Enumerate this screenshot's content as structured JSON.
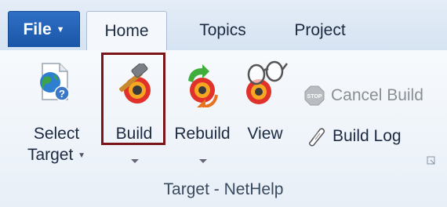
{
  "tabs": {
    "file": "File",
    "home": "Home",
    "topics": "Topics",
    "project": "Project"
  },
  "commands": {
    "select_target_line1": "Select",
    "select_target_line2": "Target",
    "build": "Build",
    "rebuild": "Rebuild",
    "view": "View",
    "cancel_build": "Cancel Build",
    "build_log": "Build Log"
  },
  "group": {
    "label": "Target - NetHelp"
  },
  "colors": {
    "file_tab": "#1a56a8",
    "highlight_border": "#7a1518",
    "disabled_text": "#8a8f96"
  },
  "icons": {
    "select_target": "globe-page-help-icon",
    "build": "hammer-disc-icon",
    "rebuild": "rebuild-arrows-disc-icon",
    "view": "glasses-disc-icon",
    "cancel_build": "stop-sign-icon",
    "build_log": "scroll-log-icon"
  }
}
